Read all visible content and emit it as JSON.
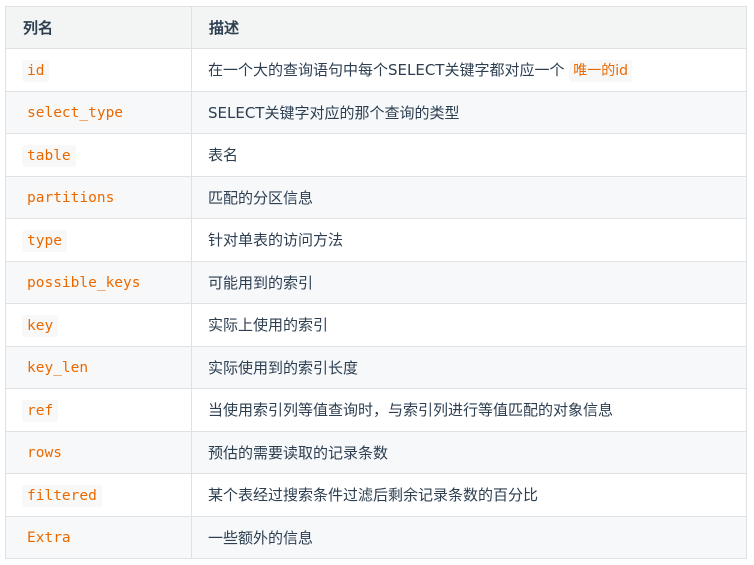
{
  "table": {
    "headers": [
      "列名",
      "描述"
    ],
    "rows": [
      {
        "name": "id",
        "desc_prefix": "在一个大的查询语句中每个SELECT关键字都对应一个",
        "desc_code": "唯一的id"
      },
      {
        "name": "select_type",
        "desc": "SELECT关键字对应的那个查询的类型"
      },
      {
        "name": "table",
        "desc": "表名"
      },
      {
        "name": "partitions",
        "desc": "匹配的分区信息"
      },
      {
        "name": "type",
        "desc": "针对单表的访问方法"
      },
      {
        "name": "possible_keys",
        "desc": "可能用到的索引"
      },
      {
        "name": "key",
        "desc": "实际上使用的索引"
      },
      {
        "name": "key_len",
        "desc": "实际使用到的索引长度"
      },
      {
        "name": "ref",
        "desc": "当使用索引列等值查询时，与索引列进行等值匹配的对象信息"
      },
      {
        "name": "rows",
        "desc": "预估的需要读取的记录条数"
      },
      {
        "name": "filtered",
        "desc": "某个表经过搜索条件过滤后剩余记录条数的百分比"
      },
      {
        "name": "Extra",
        "desc": "一些额外的信息"
      }
    ]
  }
}
